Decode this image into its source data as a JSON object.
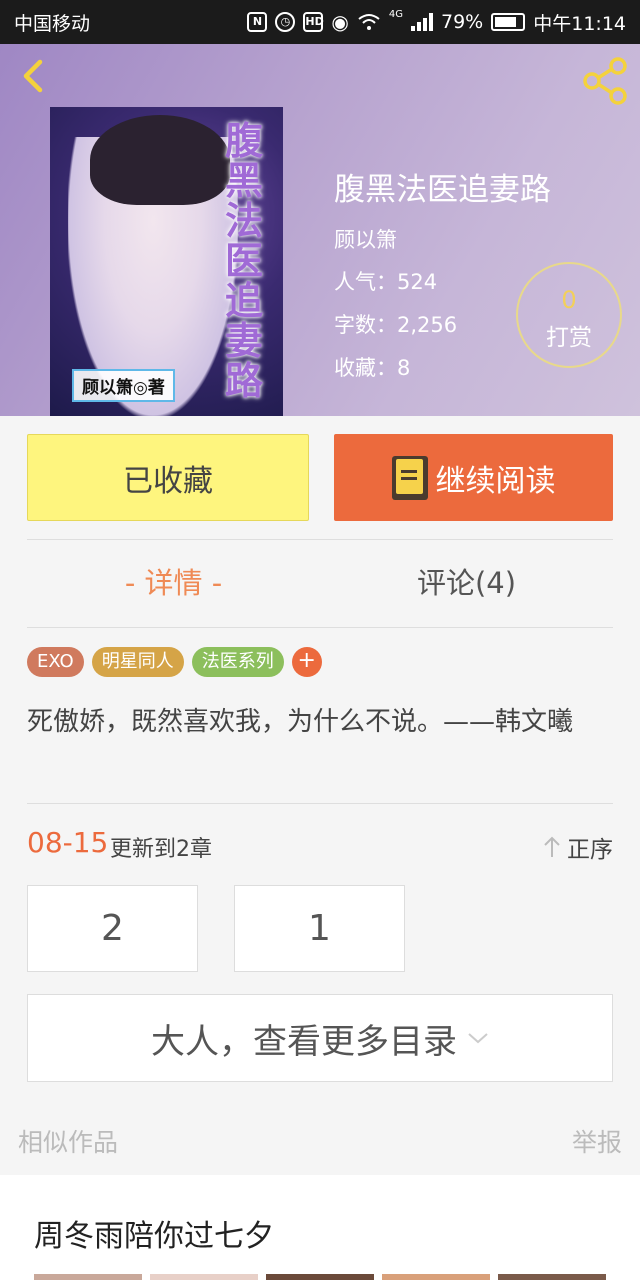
{
  "status_bar": {
    "carrier": "中国移动",
    "battery": "79%",
    "time": "中午11:14",
    "network": "4G",
    "icons": [
      "nfc-icon",
      "alarm-icon",
      "hd-icon",
      "eye-icon",
      "wifi-icon",
      "signal-icon",
      "battery-icon"
    ],
    "battery_level": 0.79
  },
  "header": {
    "back_icon": "chevron-left-icon",
    "share_icon": "share-icon"
  },
  "book": {
    "title": "腹黑法医追妻路",
    "author": "顾以箫",
    "popularity": "人气：524",
    "word_count": "字数：2,256",
    "favorites": "收藏：8",
    "tip_count": "0",
    "tip_label": "打赏",
    "cover_title": "腹黑法医追妻路",
    "cover_author": "顾以箫◎著"
  },
  "actions": {
    "favorited_label": "已收藏",
    "continue_label": "继续阅读"
  },
  "tabs": {
    "detail": "- 详情 -",
    "comments": "评论(4)"
  },
  "tags": [
    {
      "label": "EXO",
      "color": "#d07a5e"
    },
    {
      "label": "明星同人",
      "color": "#d5a447"
    },
    {
      "label": "法医系列",
      "color": "#8cbf5c"
    }
  ],
  "tag_add": "+",
  "intro": "死傲娇，既然喜欢我，为什么不说。——韩文曦",
  "updates": {
    "date": "08-15",
    "text": "更新到2章",
    "order_label": "正序"
  },
  "chapters": [
    "2",
    "1"
  ],
  "more_directory": "大人，查看更多目录",
  "similar": {
    "title": "相似作品",
    "report": "举报"
  },
  "recommendation": {
    "title": "周冬雨陪你过七夕"
  },
  "colors": {
    "accent": "#ec6a3d",
    "favorite_button": "#fef57e",
    "tab_active": "#ef8a55"
  }
}
